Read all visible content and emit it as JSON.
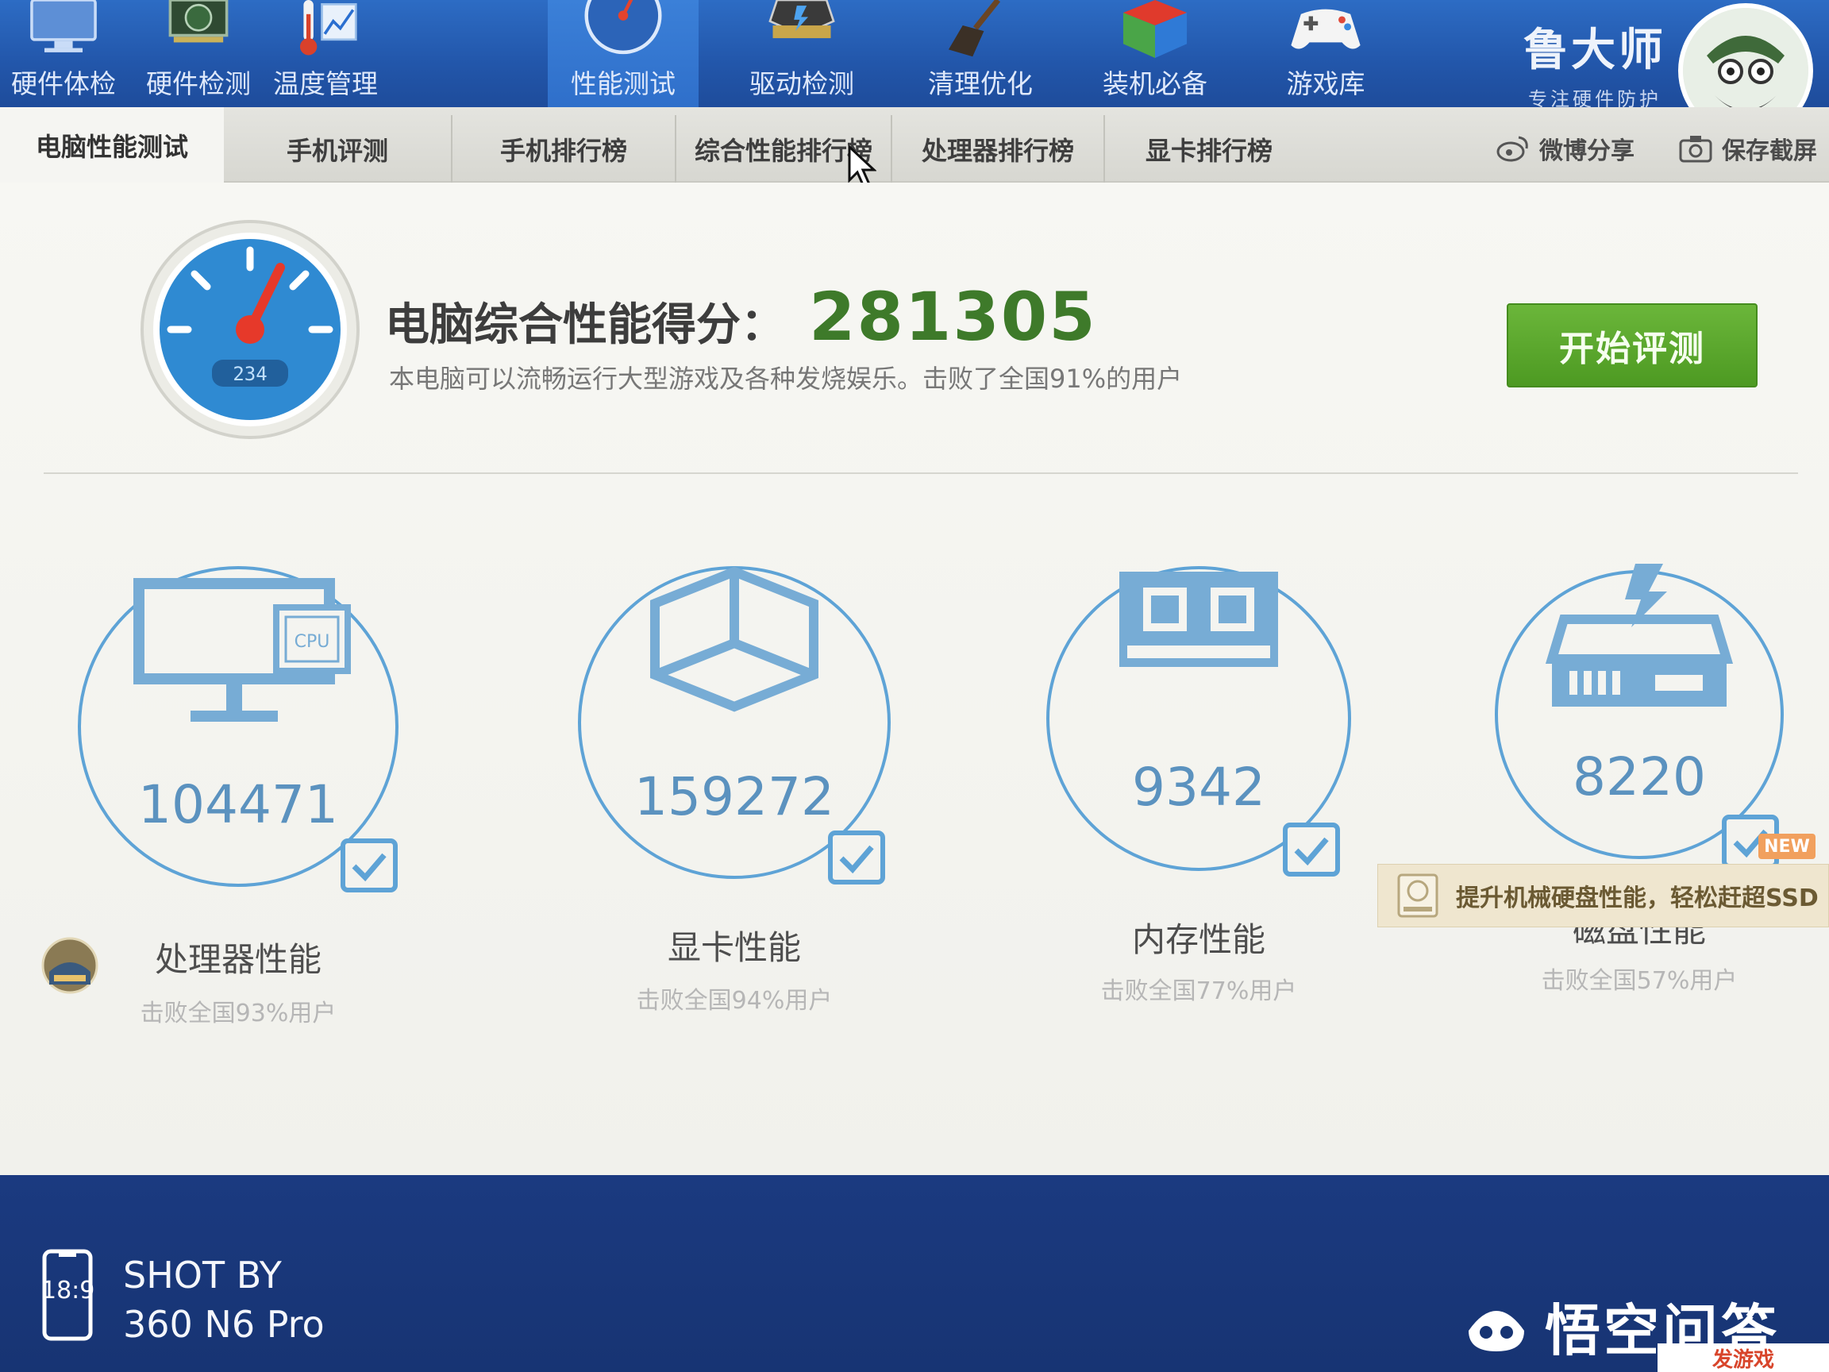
{
  "toolbar": {
    "items": [
      {
        "label": "硬件体检",
        "icon": "monitor-icon"
      },
      {
        "label": "硬件检测",
        "icon": "graphics-card-icon"
      },
      {
        "label": "温度管理",
        "icon": "thermometer-icon"
      },
      {
        "label": "性能测试",
        "icon": "speedometer-icon",
        "active": true
      },
      {
        "label": "驱动检测",
        "icon": "driver-chip-icon"
      },
      {
        "label": "清理优化",
        "icon": "broom-icon"
      },
      {
        "label": "装机必备",
        "icon": "cube-box-icon"
      },
      {
        "label": "游戏库",
        "icon": "gamepad-icon"
      }
    ]
  },
  "brand": {
    "name": "鲁大师",
    "slogan": "专注硬件防护"
  },
  "subtabs": {
    "items": [
      "电脑性能测试",
      "手机评测",
      "手机排行榜",
      "综合性能排行榜",
      "处理器排行榜",
      "显卡排行榜"
    ],
    "weibo_share": "微博分享",
    "save_screenshot": "保存截屏"
  },
  "score": {
    "label": "电脑综合性能得分：",
    "value": "281305",
    "description": "本电脑可以流畅运行大型游戏及各种发烧娱乐。击败了全国91%的用户",
    "gauge_reading": "234",
    "start_button": "开始评测"
  },
  "metrics": [
    {
      "value": "104471",
      "title": "处理器性能",
      "sub": "击败全国93%用户",
      "icon": "cpu-monitor-icon",
      "chip_text": "CPU"
    },
    {
      "value": "159272",
      "title": "显卡性能",
      "sub": "击败全国94%用户",
      "icon": "gpu-cube-icon"
    },
    {
      "value": "9342",
      "title": "内存性能",
      "sub": "击败全国77%用户",
      "icon": "memory-stick-icon"
    },
    {
      "value": "8220",
      "title": "磁盘性能",
      "sub": "击败全国57%用户",
      "icon": "hard-disk-icon"
    }
  ],
  "promo": {
    "badge": "NEW",
    "text": "提升机械硬盘性能，轻松赶超SSD"
  },
  "footer": {
    "ratio": "18:9",
    "shot_line1": "SHOT BY",
    "shot_line2": "360 N6 Pro",
    "watermark": "悟空问答",
    "watermark_small": "发游戏"
  },
  "colors": {
    "toolbar_blue": "#2256aa",
    "score_green": "#3e7a2a",
    "button_green": "#4d9a22",
    "ring_blue": "#5b92bf"
  }
}
